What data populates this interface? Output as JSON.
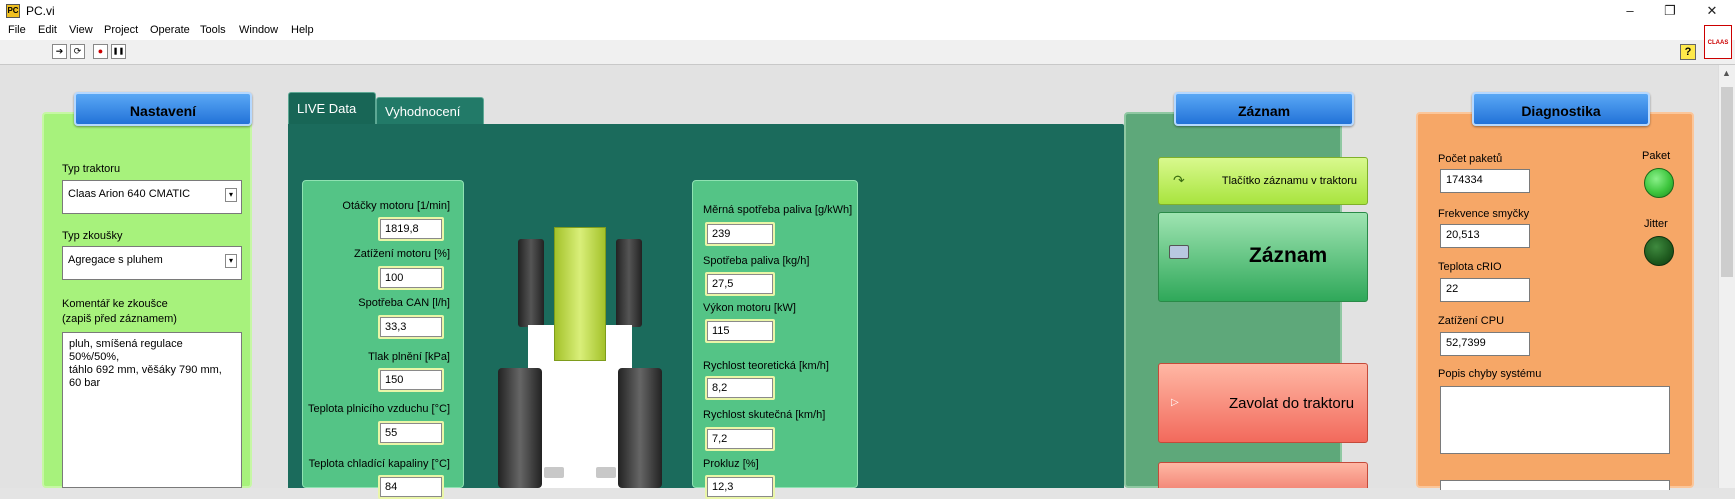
{
  "window": {
    "title": "PC.vi",
    "app_icon_text": "PC",
    "minimize": "–",
    "restore": "❐",
    "close": "✕"
  },
  "menu": [
    "File",
    "Edit",
    "View",
    "Project",
    "Operate",
    "Tools",
    "Window",
    "Help"
  ],
  "toolbar": {
    "run": "➔",
    "run_continuous": "⟳",
    "abort": "●",
    "pause": "❚❚",
    "help": "?",
    "badge": "CLAAS"
  },
  "nastaveni": {
    "title": "Nastavení",
    "tractor_type_label": "Typ traktoru",
    "tractor_type_value": "Claas Arion 640 CMATIC",
    "test_type_label": "Typ zkoušky",
    "test_type_value": "Agregace s pluhem",
    "comment_label_1": "Komentář ke zkoušce",
    "comment_label_2": "(zapiš před záznamem)",
    "comment_lines": [
      "pluh, smíšená regulace 50%/50%,",
      "táhlo 692 mm, věšáky 790 mm,",
      "60 bar"
    ]
  },
  "tabs": {
    "live": "LIVE Data",
    "eval": "Vyhodnocení"
  },
  "engine": {
    "rpm_label": "Otáčky motoru [1/min]",
    "rpm": "1819,8",
    "load_label": "Zatížení motoru [%]",
    "load": "100",
    "can_label": "Spotřeba CAN [l/h]",
    "can": "33,3",
    "boost_label": "Tlak plnění [kPa]",
    "boost": "150",
    "air_temp_label": "Teplota plnicího vzduchu [°C]",
    "air_temp": "55",
    "coolant_label": "Teplota chladící kapaliny [°C]",
    "coolant": "84"
  },
  "performance": {
    "sfc_label": "Měrná spotřeba paliva [g/kWh]",
    "sfc": "239",
    "fuel_label": "Spotřeba paliva [kg/h]",
    "fuel": "27,5",
    "power_label": "Výkon motoru [kW]",
    "power": "115",
    "v_theor_label": "Rychlost teoretická [km/h]",
    "v_theor": "8,2",
    "v_real_label": "Rychlost skutečná [km/h]",
    "v_real": "7,2",
    "slip_label": "Prokluz [%]",
    "slip": "12,3"
  },
  "zaznam": {
    "title": "Záznam",
    "tractor_record_btn": "Tlačítko záznamu v traktoru",
    "record_btn": "Záznam",
    "call_btn": "Zavolat do traktoru"
  },
  "diag": {
    "title": "Diagnostika",
    "packets_label": "Počet paketů",
    "packets": "174334",
    "loop_freq_label": "Frekvence smyčky",
    "loop_freq": "20,513",
    "crio_temp_label": "Teplota cRIO",
    "crio_temp": "22",
    "cpu_label": "Zatížení CPU",
    "cpu": "52,7399",
    "error_label": "Popis chyby systému",
    "error": "",
    "paket_led_label": "Paket",
    "jitter_led_label": "Jitter"
  },
  "colors": {
    "accent_blue": "#2e86e8",
    "teal_panel": "#1b6b5c",
    "led_on": "#3ec63e",
    "led_off": "#1e5a1e"
  }
}
